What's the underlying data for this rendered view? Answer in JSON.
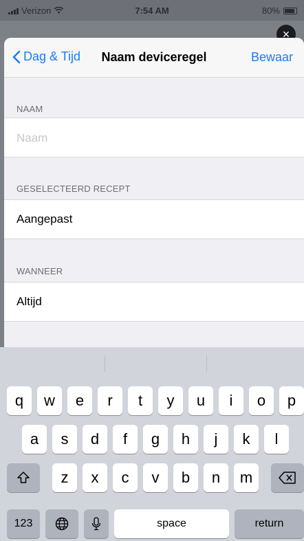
{
  "status_bar": {
    "carrier": "Verizon",
    "time": "7:54 AM",
    "battery": "80%"
  },
  "nav": {
    "back_label": "Dag & Tijd",
    "title": "Naam deviceregel",
    "save_label": "Bewaar"
  },
  "sections": {
    "name": {
      "header": "NAAM",
      "placeholder": "Naam",
      "value": ""
    },
    "recipe": {
      "header": "GESELECTEERD RECEPT",
      "value": "Aangepast"
    },
    "when": {
      "header": "WANNEER",
      "value": "Altijd"
    }
  },
  "keyboard": {
    "row1": [
      "q",
      "w",
      "e",
      "r",
      "t",
      "y",
      "u",
      "i",
      "o",
      "p"
    ],
    "row2": [
      "a",
      "s",
      "d",
      "f",
      "g",
      "h",
      "j",
      "k",
      "l"
    ],
    "row3": [
      "z",
      "x",
      "c",
      "v",
      "b",
      "n",
      "m"
    ],
    "numbers_label": "123",
    "space_label": "space",
    "return_label": "return"
  },
  "icons": [
    "wifi-icon",
    "signal-icon",
    "battery-icon",
    "close-icon",
    "chevron-left-icon",
    "shift-icon",
    "delete-icon",
    "globe-icon",
    "microphone-icon"
  ]
}
